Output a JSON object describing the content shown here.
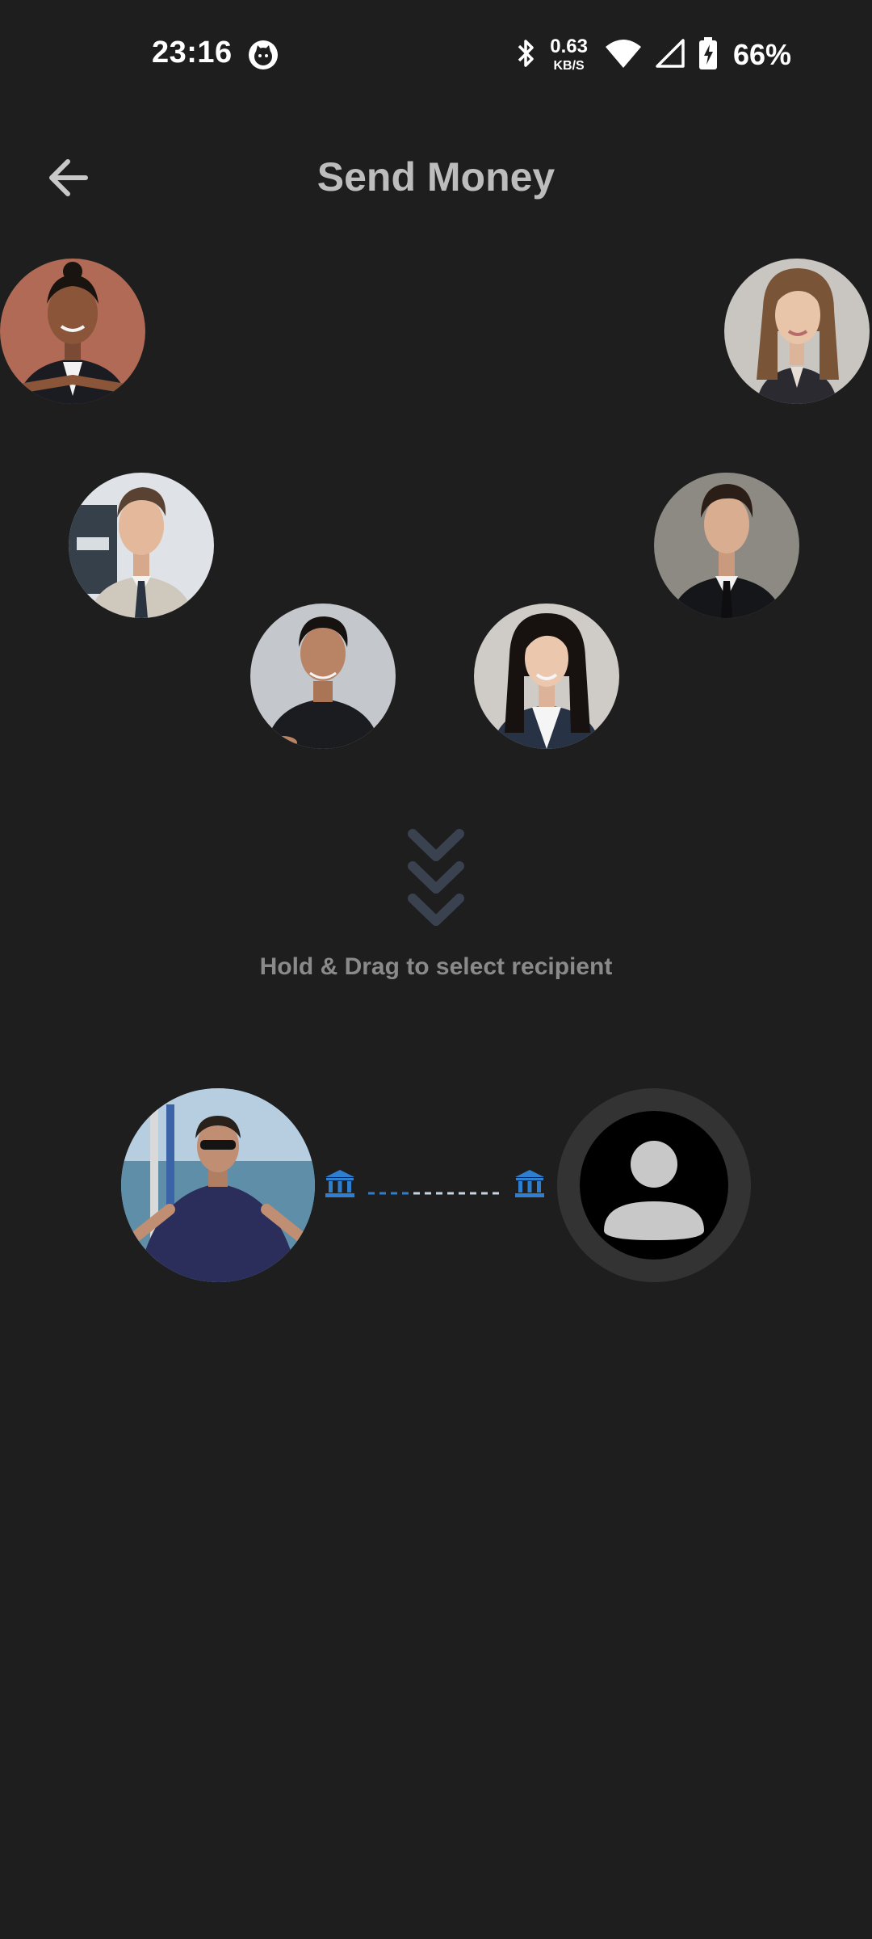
{
  "status_bar": {
    "time": "23:16",
    "network_speed_value": "0.63",
    "network_speed_unit": "KB/S",
    "battery_percent": "66%",
    "icons": [
      "app-notification-icon",
      "bluetooth-icon",
      "wifi-icon",
      "cellular-signal-icon",
      "battery-charging-icon"
    ]
  },
  "header": {
    "title": "Send Money",
    "back_icon": "arrow-left-icon"
  },
  "contacts": [
    {
      "id": "contact-1",
      "photo": "portrait"
    },
    {
      "id": "contact-2",
      "photo": "portrait"
    },
    {
      "id": "contact-3",
      "photo": "portrait"
    },
    {
      "id": "contact-4",
      "photo": "portrait"
    },
    {
      "id": "contact-5",
      "photo": "portrait"
    },
    {
      "id": "contact-6",
      "photo": "portrait"
    }
  ],
  "drag_hint": {
    "icon": "triple-chevron-down-icon",
    "text": "Hold & Drag to select recipient"
  },
  "transfer": {
    "sender_icon": "bank-icon",
    "recipient_icon": "bank-icon",
    "recipient_placeholder_icon": "user-placeholder-icon"
  },
  "colors": {
    "background": "#1e1e1e",
    "accent_blue": "#2f7fd0",
    "title_gray": "#bdbdbd",
    "hint_gray": "#8a8a8a",
    "chevron": "#3a4250"
  }
}
